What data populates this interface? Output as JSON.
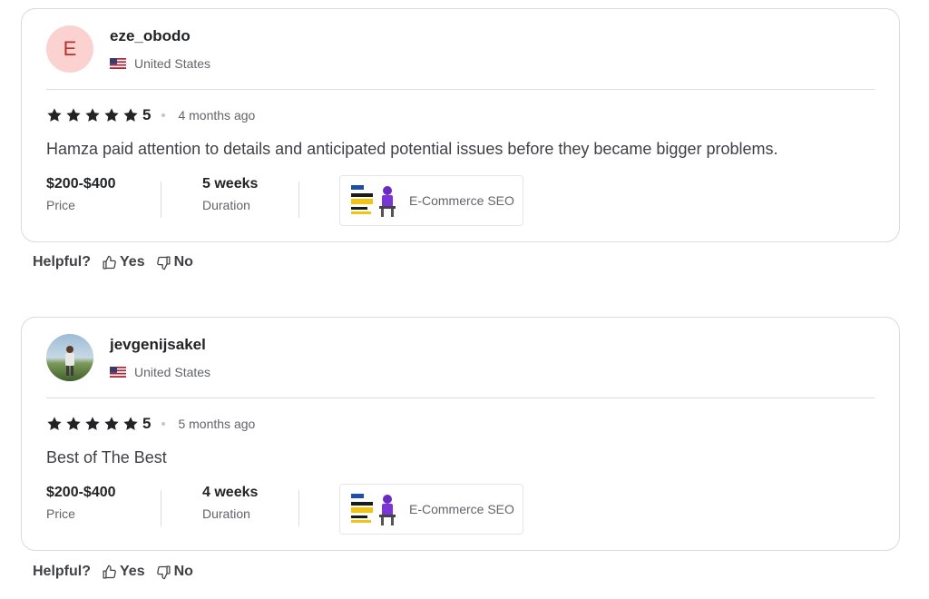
{
  "reviews": [
    {
      "avatar_letter": "E",
      "username": "eze_obodo",
      "country": "United States",
      "rating": "5",
      "time_ago": "4 months ago",
      "text": "Hamza paid attention to details and anticipated potential issues before they became bigger problems.",
      "price_value": "$200-$400",
      "price_label": "Price",
      "duration_value": "5 weeks",
      "duration_label": "Duration",
      "gig_title": "E-Commerce SEO"
    },
    {
      "username": "jevgenijsakel",
      "country": "United States",
      "rating": "5",
      "time_ago": "5 months ago",
      "text": "Best of The Best",
      "price_value": "$200-$400",
      "price_label": "Price",
      "duration_value": "4 weeks",
      "duration_label": "Duration",
      "gig_title": "E-Commerce SEO"
    }
  ],
  "helpful": {
    "label": "Helpful?",
    "yes": "Yes",
    "no": "No"
  },
  "icons": {
    "star": "star-icon",
    "flag": "us-flag-icon",
    "thumbs_up": "thumbs-up-icon",
    "thumbs_down": "thumbs-down-icon"
  },
  "colors": {
    "star": "#222325",
    "avatar_bg": "#fcd2d0",
    "avatar_text": "#b8312f",
    "border": "#dadbdd"
  }
}
